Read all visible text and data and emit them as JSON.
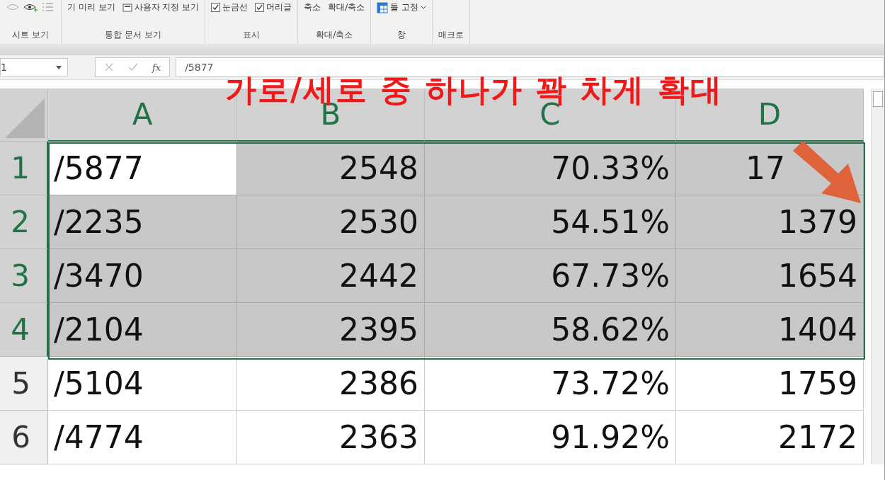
{
  "ribbon": {
    "groups": [
      {
        "label": "시트 보기"
      },
      {
        "label": "통합 문서 보기",
        "items": [
          {
            "kind": "text",
            "label": "기 미리 보기"
          },
          {
            "kind": "view",
            "label": "사용자 지정 보기"
          }
        ]
      },
      {
        "label": "표시",
        "items": [
          {
            "kind": "check",
            "label": "눈금선",
            "checked": true
          },
          {
            "kind": "check",
            "label": "머리글",
            "checked": true
          }
        ]
      },
      {
        "label": "확대/축소",
        "items": [
          {
            "kind": "text",
            "label": "축소"
          },
          {
            "kind": "text",
            "label": "확대/축소"
          }
        ]
      },
      {
        "label": "창",
        "items": [
          {
            "kind": "freeze",
            "label": "틀 고정"
          }
        ]
      },
      {
        "label": "매크로"
      }
    ]
  },
  "formula_bar": {
    "name_box": "1",
    "fx": "fx",
    "value": "/5877"
  },
  "sheet": {
    "columns": [
      {
        "label": "A",
        "selected": true
      },
      {
        "label": "B",
        "selected": true
      },
      {
        "label": "C",
        "selected": true
      },
      {
        "label": "D",
        "selected": true
      }
    ],
    "rows": [
      {
        "header": "1",
        "selected": true,
        "active": true,
        "tail_covered": true,
        "cells": [
          "/5877",
          "2548",
          "70.33%",
          "17"
        ]
      },
      {
        "header": "2",
        "selected": true,
        "active": false,
        "tail_covered": false,
        "cells": [
          "/2235",
          "2530",
          "54.51%",
          "1379"
        ]
      },
      {
        "header": "3",
        "selected": true,
        "active": false,
        "tail_covered": false,
        "cells": [
          "/3470",
          "2442",
          "67.73%",
          "1654"
        ]
      },
      {
        "header": "4",
        "selected": true,
        "active": false,
        "tail_covered": false,
        "cells": [
          "/2104",
          "2395",
          "58.62%",
          "1404"
        ]
      },
      {
        "header": "5",
        "selected": false,
        "active": false,
        "tail_covered": false,
        "cells": [
          "/5104",
          "2386",
          "73.72%",
          "1759"
        ]
      },
      {
        "header": "6",
        "selected": false,
        "active": false,
        "tail_covered": false,
        "cells": [
          "/4774",
          "2363",
          "91.92%",
          "2172"
        ]
      }
    ]
  },
  "annotation": {
    "caption": "가로/세로 중 하나가 꽉 차게 확대"
  }
}
